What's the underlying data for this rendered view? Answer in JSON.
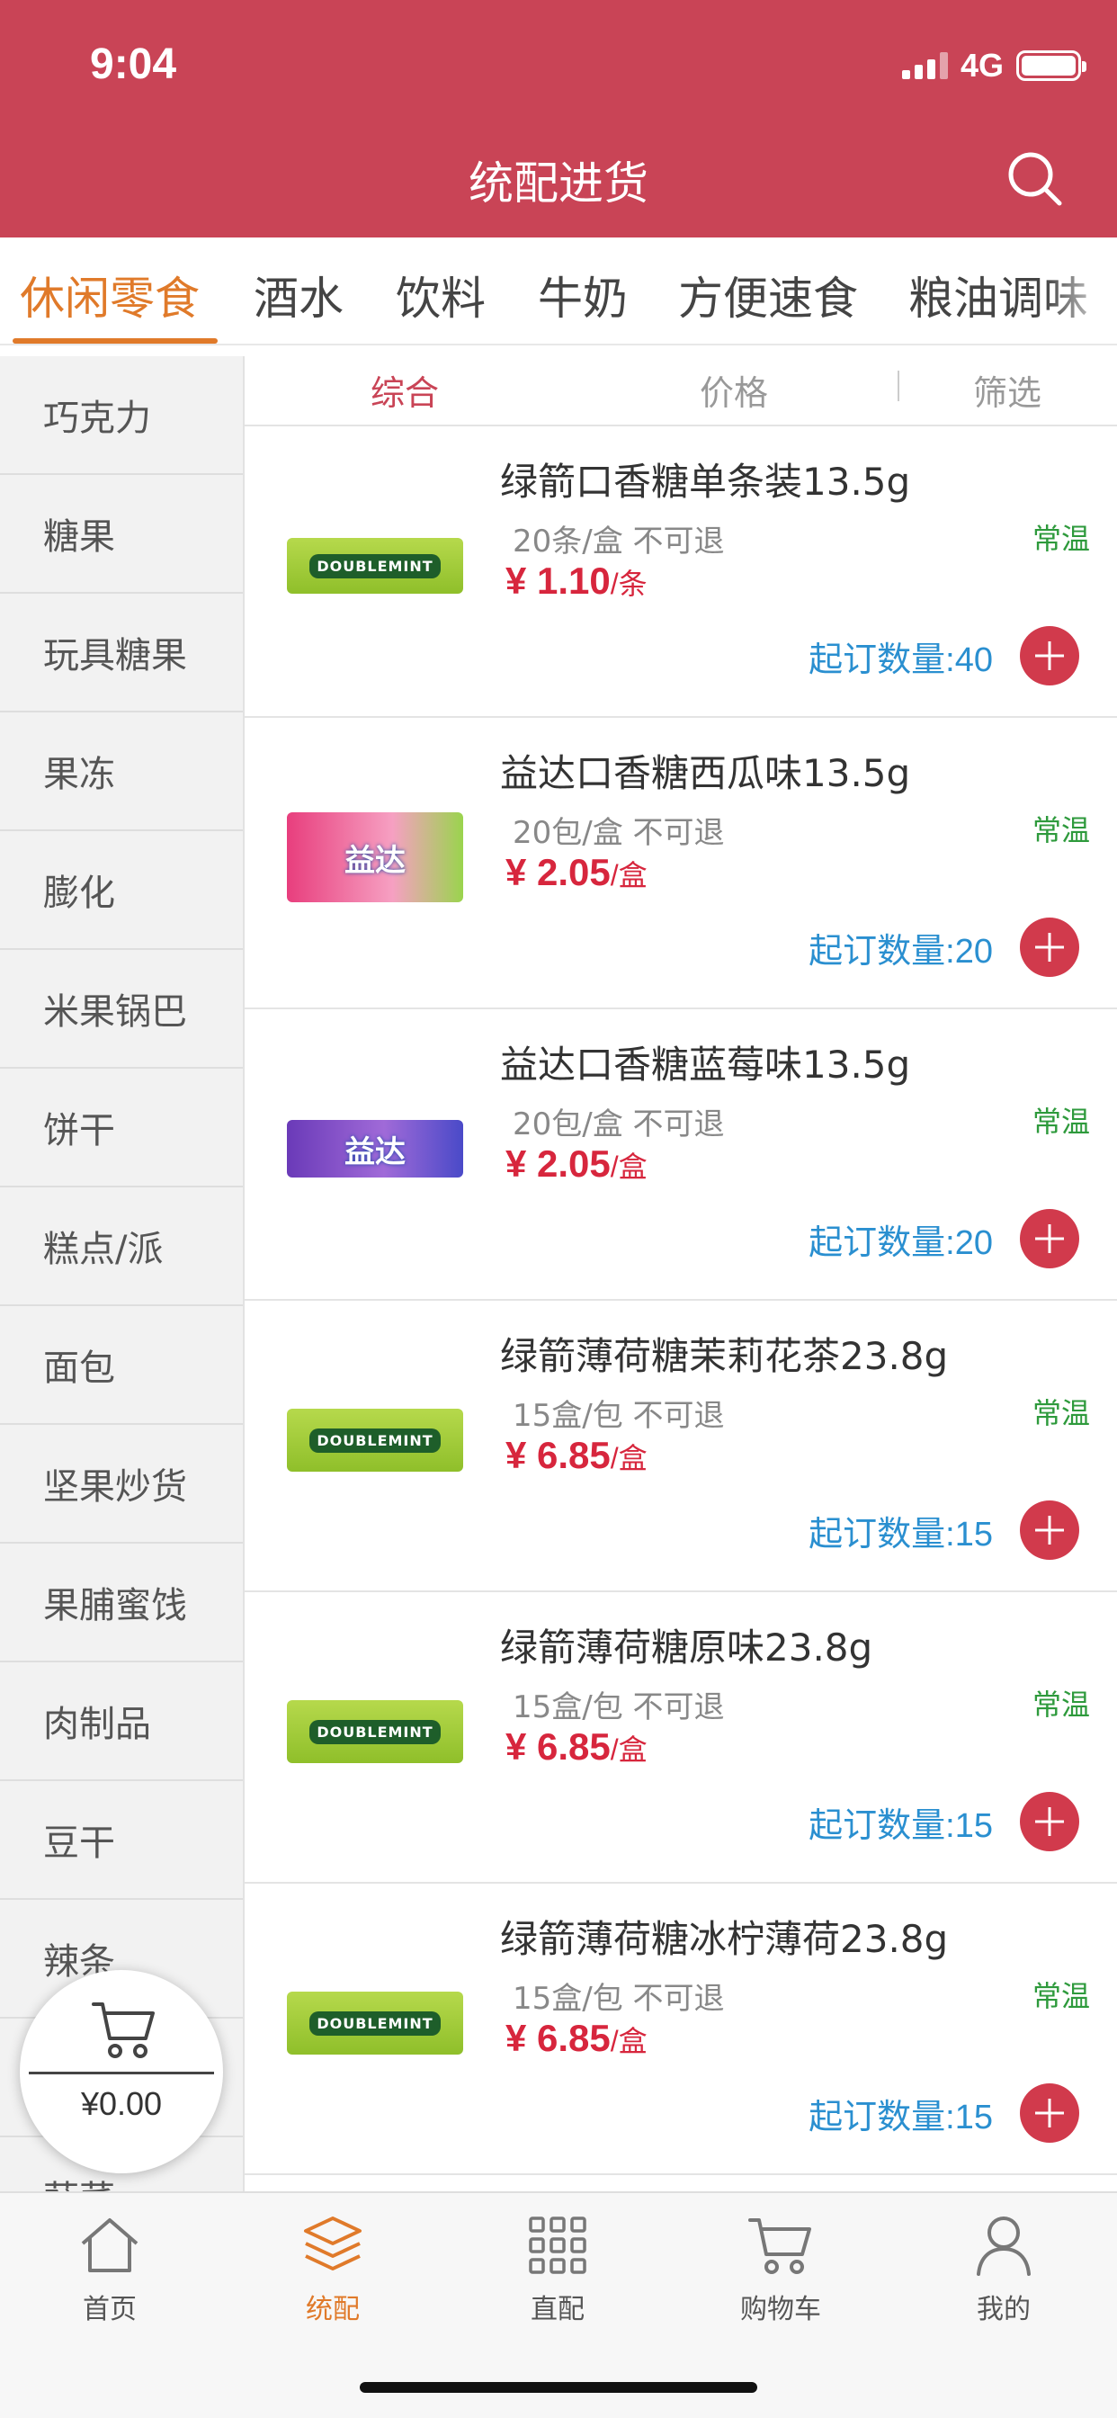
{
  "status_bar": {
    "time": "9:04",
    "network": "4G"
  },
  "header": {
    "title": "统配进货"
  },
  "colors": {
    "brand_red": "#c94456",
    "accent_orange": "#e07a2a",
    "price_red": "#d7263d",
    "min_blue": "#2a8fd0",
    "temp_green": "#2e9a3c"
  },
  "category_tabs": [
    {
      "label": "休闲零食",
      "active": true
    },
    {
      "label": "酒水"
    },
    {
      "label": "饮料"
    },
    {
      "label": "牛奶"
    },
    {
      "label": "方便速食"
    },
    {
      "label": "粮油调味"
    }
  ],
  "sidebar": {
    "items": [
      "巧克力",
      "糖果",
      "玩具糖果",
      "果冻",
      "膨化",
      "米果锅巴",
      "饼干",
      "糕点/派",
      "面包",
      "坚果炒货",
      "果脯蜜饯",
      "肉制品",
      "豆干",
      "辣条",
      "",
      "蔬菜"
    ]
  },
  "sort_bar": {
    "comprehensive": "综合",
    "price": "价格",
    "filter": "筛选"
  },
  "products": [
    {
      "name": "绿箭口香糖单条装13.5g",
      "spec": "20条/盒 不可退",
      "price": "¥ 1.10",
      "unit": "/条",
      "temp": "常温",
      "min_order": "起订数量:40",
      "pack_text": "DOUBLEMINT"
    },
    {
      "name": "益达口香糖西瓜味13.5g",
      "spec": "20包/盒 不可退",
      "price": "¥ 2.05",
      "unit": "/盒",
      "temp": "常温",
      "min_order": "起订数量:20",
      "pack_text": "益达"
    },
    {
      "name": "益达口香糖蓝莓味13.5g",
      "spec": "20包/盒 不可退",
      "price": "¥ 2.05",
      "unit": "/盒",
      "temp": "常温",
      "min_order": "起订数量:20",
      "pack_text": "益达"
    },
    {
      "name": "绿箭薄荷糖茉莉花茶23.8g",
      "spec": "15盒/包 不可退",
      "price": "¥ 6.85",
      "unit": "/盒",
      "temp": "常温",
      "min_order": "起订数量:15",
      "pack_text": "DOUBLEMINT"
    },
    {
      "name": "绿箭薄荷糖原味23.8g",
      "spec": "15盒/包 不可退",
      "price": "¥ 6.85",
      "unit": "/盒",
      "temp": "常温",
      "min_order": "起订数量:15",
      "pack_text": "DOUBLEMINT"
    },
    {
      "name": "绿箭薄荷糖冰柠薄荷23.8g",
      "spec": "15盒/包 不可退",
      "price": "¥ 6.85",
      "unit": "/盒",
      "temp": "常温",
      "min_order": "起订数量:15",
      "pack_text": "DOUBLEMINT"
    }
  ],
  "floating_cart": {
    "total": "¥0.00"
  },
  "bottom_nav": [
    {
      "label": "首页",
      "icon": "home-icon"
    },
    {
      "label": "统配",
      "icon": "layers-icon",
      "active": true
    },
    {
      "label": "直配",
      "icon": "grid-icon"
    },
    {
      "label": "购物车",
      "icon": "cart-icon"
    },
    {
      "label": "我的",
      "icon": "user-icon"
    }
  ]
}
